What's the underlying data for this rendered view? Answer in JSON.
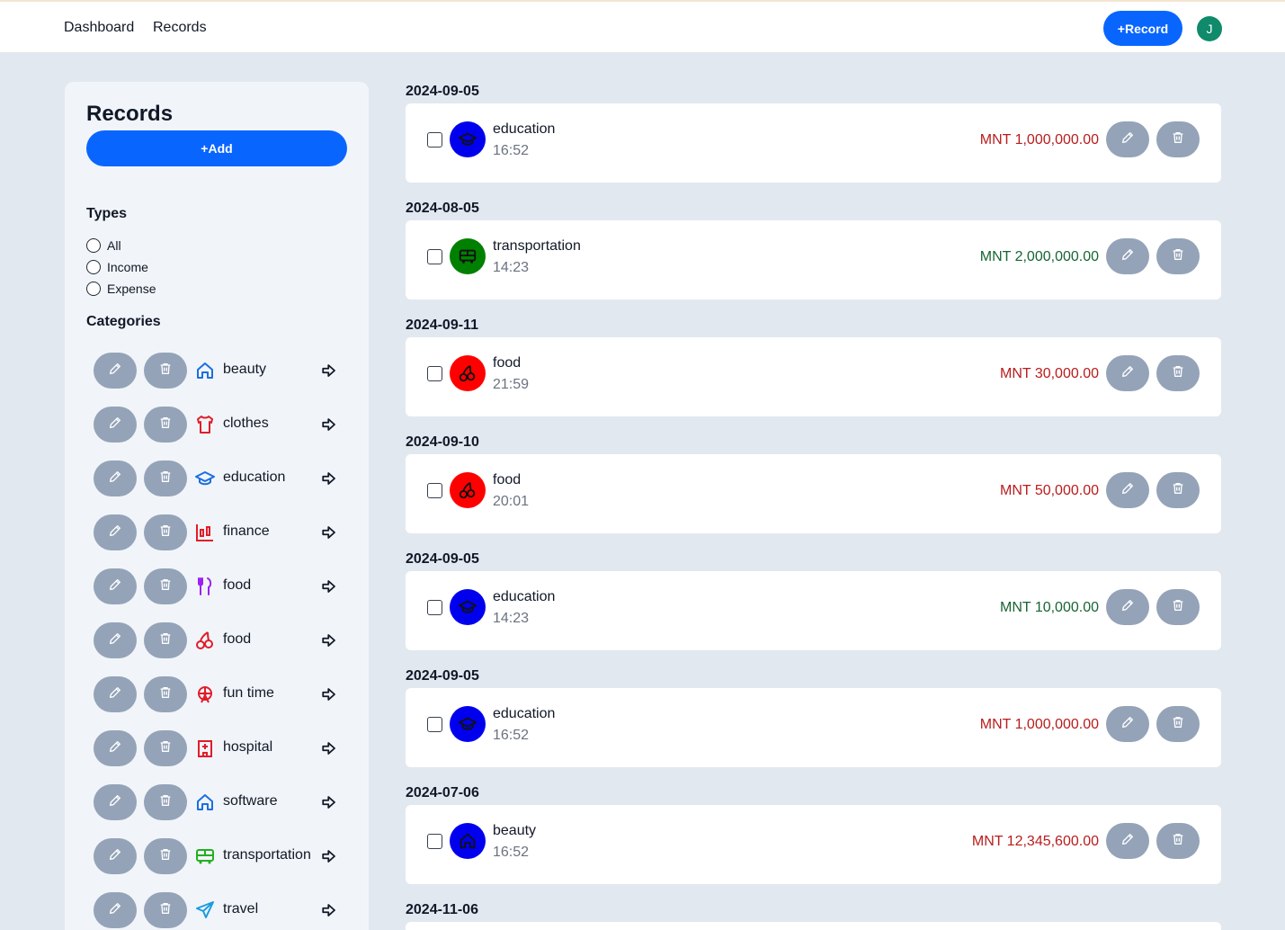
{
  "nav": {
    "links": [
      "Dashboard",
      "Records"
    ],
    "record_button": "+Record",
    "avatar_initial": "J"
  },
  "sidebar": {
    "title": "Records",
    "add_button": "+Add",
    "types_title": "Types",
    "types": [
      "All",
      "Income",
      "Expense"
    ],
    "categories_title": "Categories",
    "categories": [
      {
        "label": "beauty",
        "icon": "home-icon",
        "color": "#1d6fe0"
      },
      {
        "label": "clothes",
        "icon": "tshirt-icon",
        "color": "#e11d2a"
      },
      {
        "label": "education",
        "icon": "graduation-cap-icon",
        "color": "#1d6fe0"
      },
      {
        "label": "finance",
        "icon": "chart-icon",
        "color": "#e11d2a"
      },
      {
        "label": "food",
        "icon": "fork-knife-icon",
        "color": "#a020f0"
      },
      {
        "label": "food",
        "icon": "cherries-icon",
        "color": "#e11d2a"
      },
      {
        "label": "fun time",
        "icon": "ferris-wheel-icon",
        "color": "#e11d2a"
      },
      {
        "label": "hospital",
        "icon": "hospital-icon",
        "color": "#e11d2a"
      },
      {
        "label": "software",
        "icon": "home-icon",
        "color": "#1d6fe0"
      },
      {
        "label": "transportation",
        "icon": "bus-icon",
        "color": "#22b022"
      },
      {
        "label": "travel",
        "icon": "airplane-icon",
        "color": "#1d9be0"
      }
    ]
  },
  "records": [
    {
      "date": "2024-09-05",
      "name": "education",
      "time": "16:52",
      "amount": "MNT 1,000,000.00",
      "type": "expense",
      "icon": "graduation-cap-icon",
      "icon_bg": "#0000ee"
    },
    {
      "date": "2024-08-05",
      "name": "transportation",
      "time": "14:23",
      "amount": "MNT 2,000,000.00",
      "type": "income",
      "icon": "bus-icon",
      "icon_bg": "#008000"
    },
    {
      "date": "2024-09-11",
      "name": "food",
      "time": "21:59",
      "amount": "MNT 30,000.00",
      "type": "expense",
      "icon": "cherries-icon",
      "icon_bg": "#ff0000"
    },
    {
      "date": "2024-09-10",
      "name": "food",
      "time": "20:01",
      "amount": "MNT 50,000.00",
      "type": "expense",
      "icon": "cherries-icon",
      "icon_bg": "#ff0000"
    },
    {
      "date": "2024-09-05",
      "name": "education",
      "time": "14:23",
      "amount": "MNT 10,000.00",
      "type": "income",
      "icon": "graduation-cap-icon",
      "icon_bg": "#0000ee"
    },
    {
      "date": "2024-09-05",
      "name": "education",
      "time": "16:52",
      "amount": "MNT 1,000,000.00",
      "type": "expense",
      "icon": "graduation-cap-icon",
      "icon_bg": "#0000ee"
    },
    {
      "date": "2024-07-06",
      "name": "beauty",
      "time": "16:52",
      "amount": "MNT 12,345,600.00",
      "type": "expense",
      "icon": "home-icon",
      "icon_bg": "#0000ee"
    }
  ],
  "trailing_date": "2024-11-06"
}
